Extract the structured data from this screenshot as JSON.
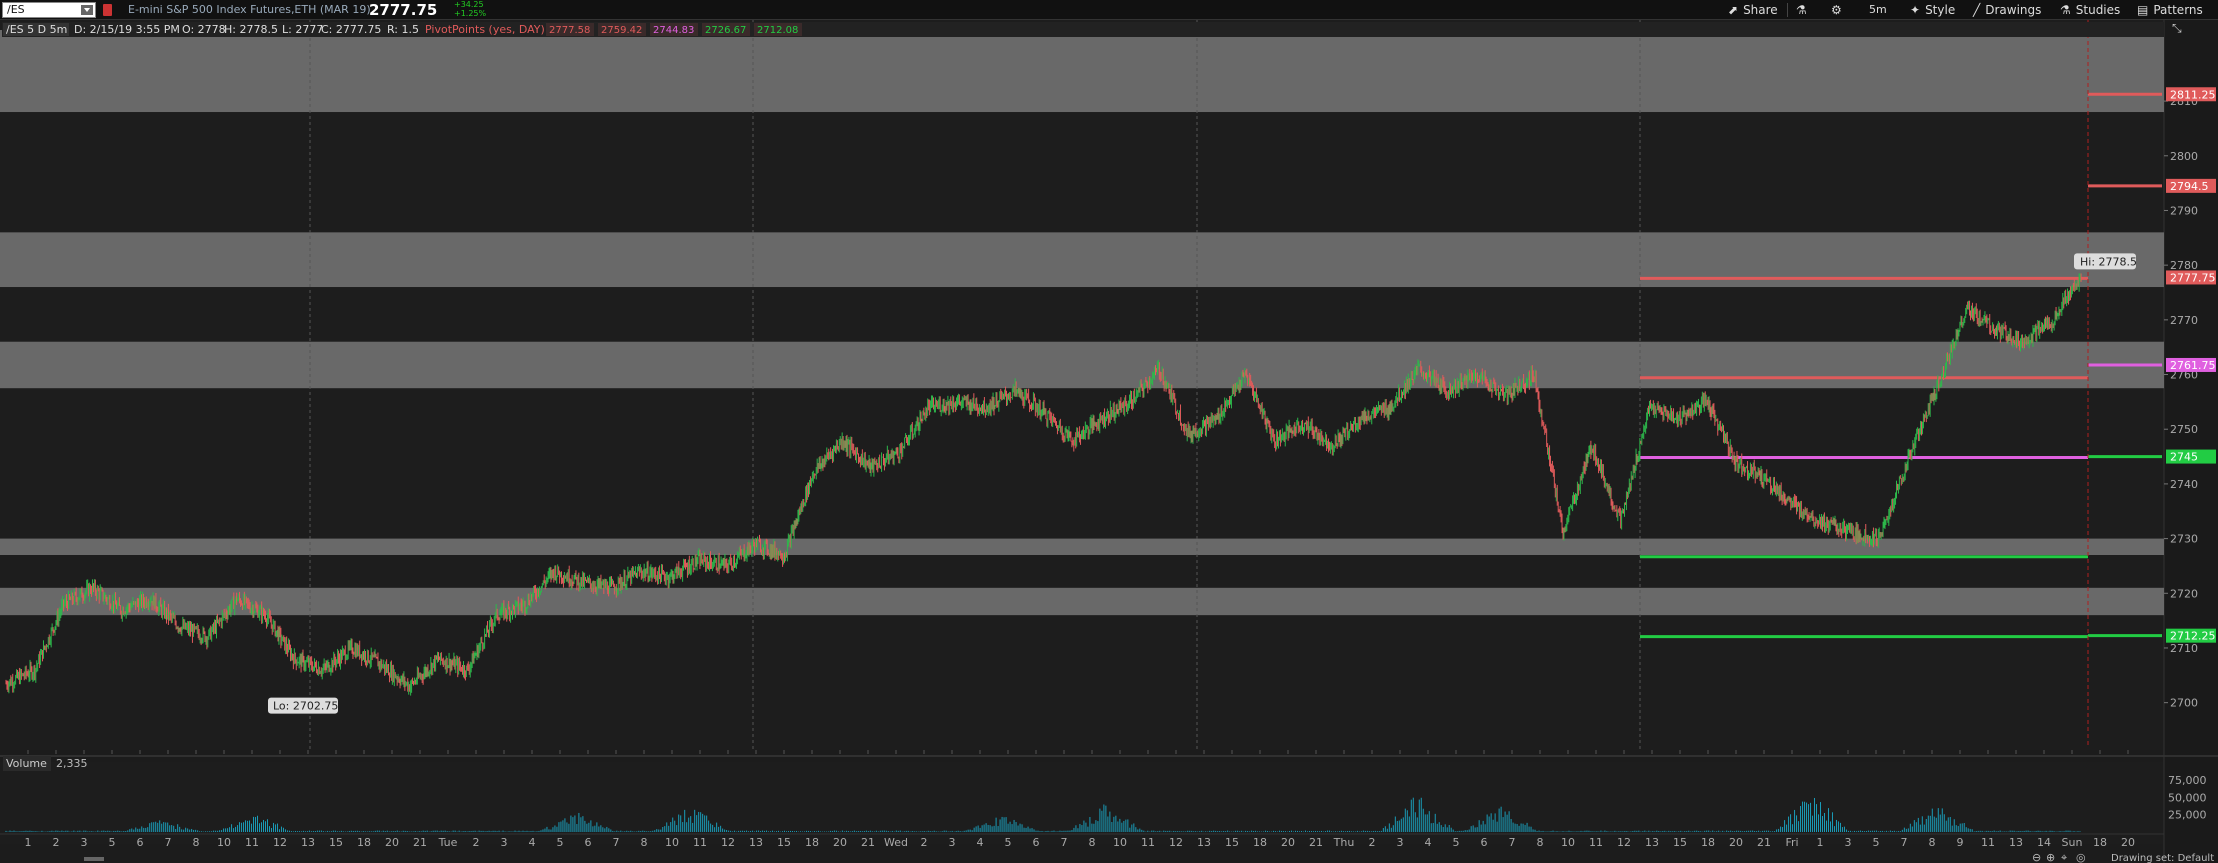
{
  "toolbar": {
    "symbol": "/ES",
    "instrument_title": "E-mini S&P 500 Index Futures,ETH (MAR 19)",
    "last_price": "2777.75",
    "net_change_top": "+34.25",
    "net_change_bottom": "+1.25%",
    "share_label": "Share",
    "timeframe_label": "5m",
    "style_label": "Style",
    "drawings_label": "Drawings",
    "studies_label": "Studies",
    "patterns_label": "Patterns"
  },
  "chart_header": {
    "label": "/ES 5 D 5m",
    "date": "D: 2/15/19 3:55 PM",
    "open": "O: 2778",
    "high": "H: 2778.5",
    "low": "L: 2777",
    "close": "C: 2777.75",
    "range": "R: 1.5",
    "study_name": "PivotPoints (yes, DAY)",
    "study_values": [
      {
        "text": "2777.58",
        "color": "#e05b5b"
      },
      {
        "text": "2759.42",
        "color": "#e05b5b"
      },
      {
        "text": "2744.83",
        "color": "#e060e0"
      },
      {
        "text": "2726.67",
        "color": "#22cc44"
      },
      {
        "text": "2712.08",
        "color": "#22cc44"
      }
    ]
  },
  "chart_data": {
    "type": "candlestick",
    "y_range": [
      2695,
      2823
    ],
    "y_ticks": [
      2700,
      2710,
      2720,
      2730,
      2740,
      2750,
      2760,
      2770,
      2780,
      2790,
      2800,
      2810
    ],
    "x_tick_labels": [
      "1",
      "2",
      "3",
      "5",
      "6",
      "7",
      "8",
      "10",
      "11",
      "12",
      "13",
      "15",
      "18",
      "20",
      "21",
      "Tue",
      "2",
      "3",
      "4",
      "5",
      "6",
      "7",
      "8",
      "10",
      "11",
      "12",
      "13",
      "15",
      "18",
      "20",
      "21",
      "Wed",
      "2",
      "3",
      "4",
      "5",
      "6",
      "7",
      "8",
      "10",
      "11",
      "12",
      "13",
      "15",
      "18",
      "20",
      "21",
      "Thu",
      "2",
      "3",
      "4",
      "5",
      "6",
      "7",
      "8",
      "10",
      "11",
      "12",
      "13",
      "15",
      "18",
      "20",
      "21",
      "Fri",
      "1",
      "3",
      "5",
      "7",
      "8",
      "9",
      "11",
      "13",
      "14",
      "Sun",
      "18",
      "20"
    ],
    "day_labels": [
      "Tue",
      "Wed",
      "Thu",
      "Fri",
      "Sun"
    ],
    "zones": [
      {
        "low": 2808,
        "high": 2823
      },
      {
        "low": 2776,
        "high": 2786
      },
      {
        "low": 2757.5,
        "high": 2766
      },
      {
        "low": 2727,
        "high": 2730
      },
      {
        "low": 2716,
        "high": 2721
      }
    ],
    "pivot_levels": [
      {
        "value": 2777.58,
        "color": "#e05b5b"
      },
      {
        "value": 2759.42,
        "color": "#e05b5b"
      },
      {
        "value": 2744.83,
        "color": "#e060e0"
      },
      {
        "value": 2726.67,
        "color": "#22cc44"
      },
      {
        "value": 2712.08,
        "color": "#22cc44"
      }
    ],
    "next_session_levels": [
      {
        "value": 2811.25,
        "label": "2811.25",
        "color": "#e05b5b"
      },
      {
        "value": 2794.5,
        "label": "2794.5",
        "color": "#e05b5b"
      },
      {
        "value": 2761.75,
        "label": "2761.75",
        "color": "#e060e0"
      },
      {
        "value": 2745,
        "label": "2745",
        "color": "#22cc44"
      },
      {
        "value": 2712.25,
        "label": "2712.25",
        "color": "#22cc44"
      }
    ],
    "last_price_label": "2777.75",
    "hi_label": "Hi: 2778.5",
    "lo_label": "Lo: 2702.75",
    "hi_value": 2778.5,
    "lo_value": 2702.75,
    "price_path": [
      2703.5,
      2706,
      2718,
      2721,
      2717,
      2719,
      2714,
      2712,
      2719,
      2716,
      2708,
      2706,
      2710,
      2707,
      2703,
      2708,
      2706,
      2716,
      2718,
      2724,
      2722,
      2721,
      2724,
      2723,
      2726,
      2725,
      2729,
      2727,
      2742,
      2748,
      2743,
      2746,
      2754,
      2755,
      2754,
      2757,
      2753,
      2748,
      2752,
      2755,
      2761,
      2749,
      2752,
      2760,
      2748,
      2751,
      2747,
      2752,
      2754,
      2761,
      2757,
      2760,
      2756,
      2760,
      2731,
      2747,
      2733,
      2754,
      2752,
      2755,
      2744,
      2741,
      2736,
      2733,
      2731,
      2730,
      2745,
      2758,
      2772,
      2768,
      2766,
      2770,
      2778
    ],
    "volume_axis": {
      "max": 75000,
      "ticks": [
        {
          "value": 75000,
          "label": "75,000"
        },
        {
          "value": 50000,
          "label": "50,000"
        },
        {
          "value": 25000,
          "label": "25,000"
        }
      ]
    },
    "volume_label": "Volume",
    "volume_value": "2,335",
    "volume_clusters": [
      {
        "frac": 0.075,
        "peak": 18000
      },
      {
        "frac": 0.12,
        "peak": 28000
      },
      {
        "frac": 0.275,
        "peak": 30000
      },
      {
        "frac": 0.33,
        "peak": 40000
      },
      {
        "frac": 0.48,
        "peak": 25000
      },
      {
        "frac": 0.53,
        "peak": 45000
      },
      {
        "frac": 0.68,
        "peak": 55000
      },
      {
        "frac": 0.72,
        "peak": 38000
      },
      {
        "frac": 0.87,
        "peak": 60000
      },
      {
        "frac": 0.93,
        "peak": 45000
      }
    ],
    "drawing_set_label": "Drawing set: Default"
  },
  "colors": {
    "zone": "#777777",
    "candle_up": "#2db84b",
    "candle_down": "#e05b5b",
    "volume": "#1a9cb8",
    "pivot_red": "#e05b5b",
    "pivot_magenta": "#e060e0",
    "pivot_green": "#22cc44"
  }
}
